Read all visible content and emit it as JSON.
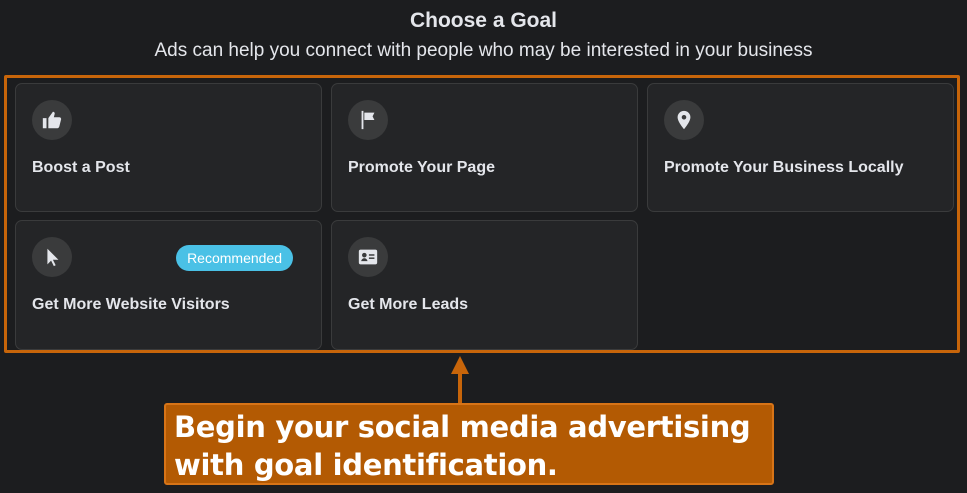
{
  "header": {
    "title": "Choose a Goal",
    "subtitle": "Ads can help you connect with people who may be interested in your business"
  },
  "goals": [
    {
      "label": "Boost a Post",
      "icon": "thumbs-up-icon"
    },
    {
      "label": "Promote Your Page",
      "icon": "flag-icon"
    },
    {
      "label": "Promote Your Business Locally",
      "icon": "location-pin-icon"
    },
    {
      "label": "Get More Website Visitors",
      "icon": "cursor-icon",
      "badge": "Recommended"
    },
    {
      "label": "Get More Leads",
      "icon": "contact-card-icon"
    }
  ],
  "callout": {
    "text": "Begin your social media advertising with goal identification."
  },
  "colors": {
    "background": "#1c1d1f",
    "card": "#242527",
    "highlight": "#c7650a",
    "badge": "#4ac1e6",
    "callout": "#b35a03"
  }
}
